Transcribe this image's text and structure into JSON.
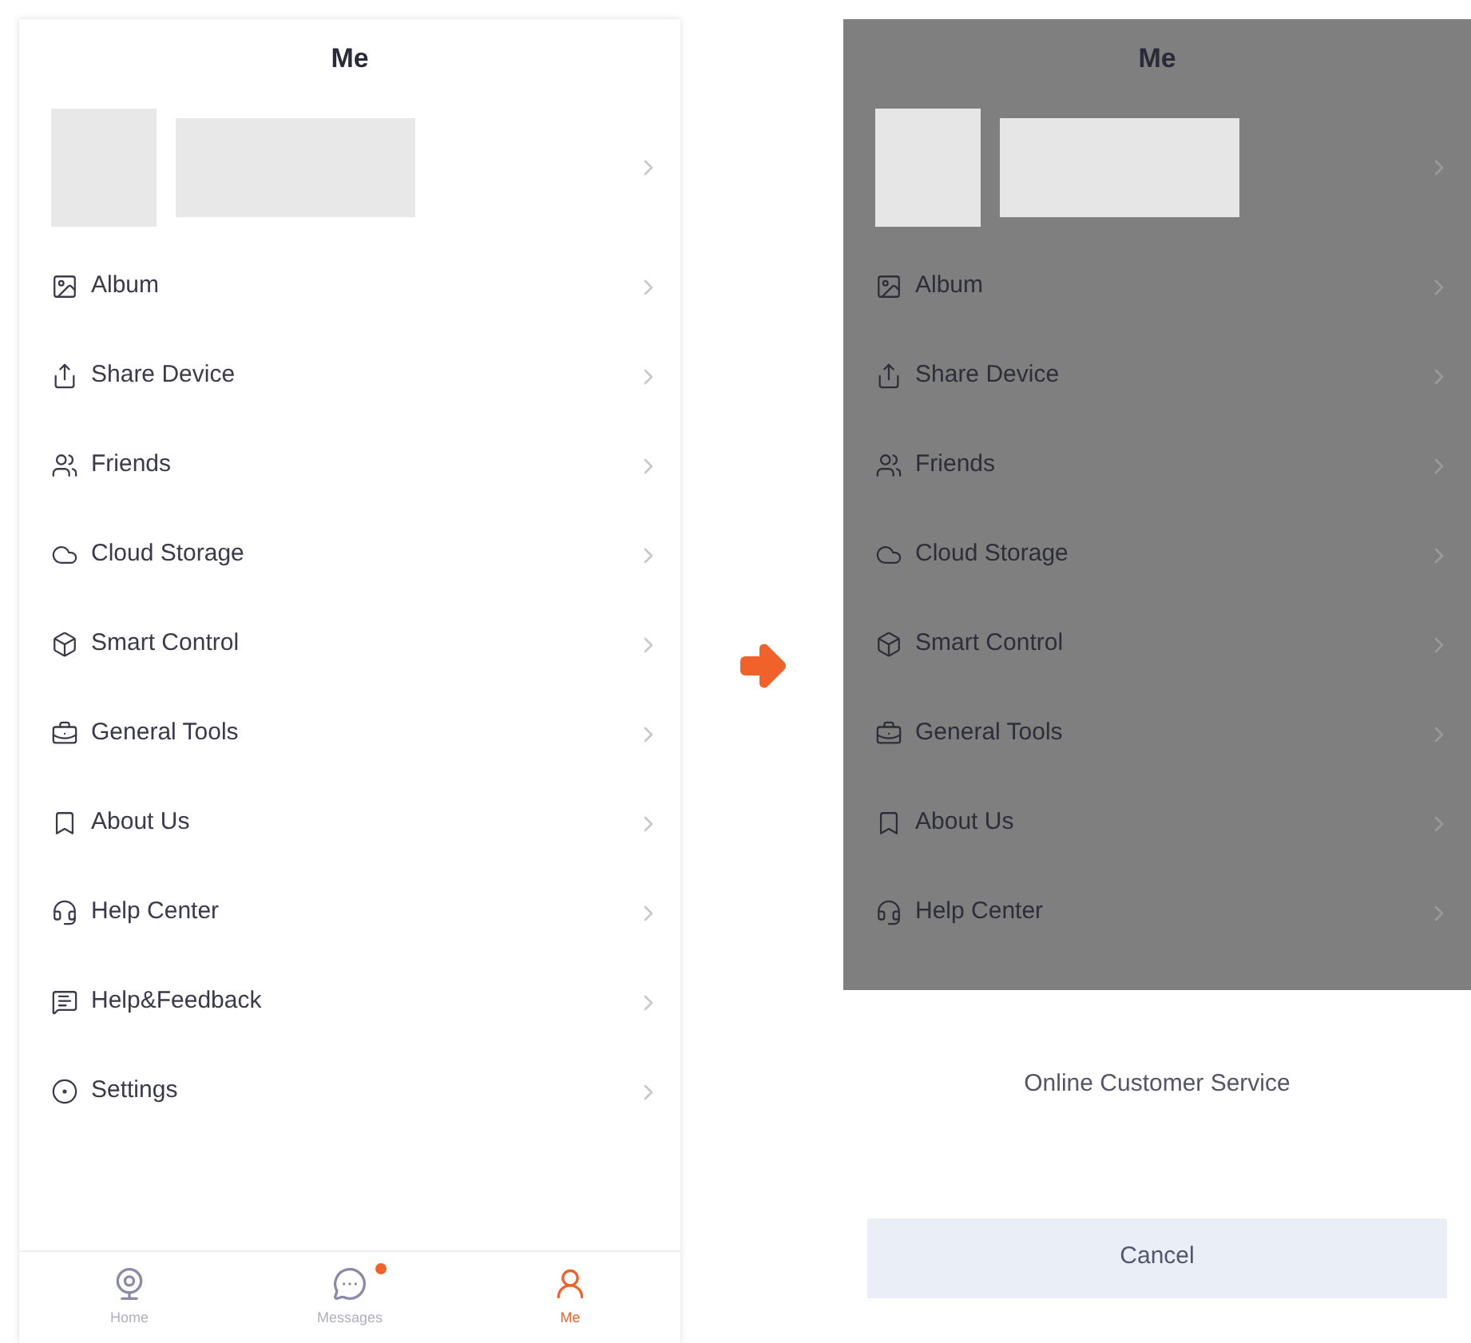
{
  "left_screen": {
    "title": "Me",
    "menu": [
      {
        "label": "Album"
      },
      {
        "label": "Share Device"
      },
      {
        "label": "Friends"
      },
      {
        "label": "Cloud Storage"
      },
      {
        "label": "Smart Control"
      },
      {
        "label": "General Tools"
      },
      {
        "label": "About Us"
      },
      {
        "label": "Help Center"
      },
      {
        "label": "Help&Feedback"
      },
      {
        "label": "Settings"
      }
    ],
    "tabs": [
      {
        "label": "Home",
        "selected": false,
        "badge": false
      },
      {
        "label": "Messages",
        "selected": false,
        "badge": true
      },
      {
        "label": "Me",
        "selected": true,
        "badge": false
      }
    ]
  },
  "right_screen": {
    "title": "Me",
    "menu": [
      {
        "label": "Album"
      },
      {
        "label": "Share Device"
      },
      {
        "label": "Friends"
      },
      {
        "label": "Cloud Storage"
      },
      {
        "label": "Smart Control"
      },
      {
        "label": "General Tools"
      },
      {
        "label": "About Us"
      },
      {
        "label": "Help Center"
      }
    ],
    "sheet": {
      "option": "Online Customer Service",
      "cancel": "Cancel"
    }
  }
}
